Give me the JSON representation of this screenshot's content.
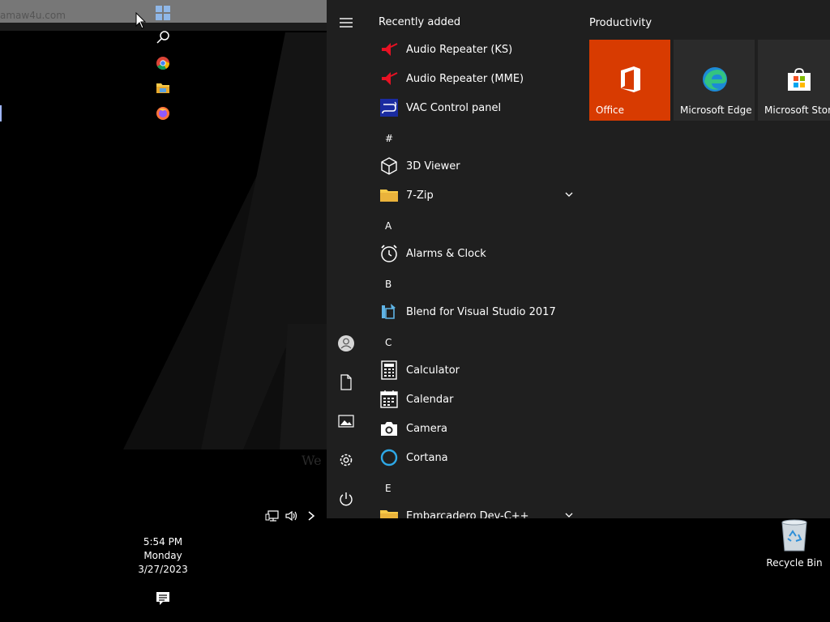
{
  "desktop": {
    "url_fragment": "amaw4u.com",
    "watermark_text": "We"
  },
  "taskbar": {
    "icons": [
      "windows-start-icon",
      "search-icon",
      "chrome-icon",
      "file-explorer-icon",
      "firefox-icon"
    ],
    "tray_icons": [
      "network-icon",
      "volume-icon",
      "chevron-right-icon"
    ],
    "clock": {
      "time": "5:54 PM",
      "day": "Monday",
      "date": "3/27/2023"
    }
  },
  "start_menu": {
    "rail_icons": [
      "hamburger-icon",
      "user-icon",
      "documents-icon",
      "pictures-icon",
      "settings-icon",
      "power-icon"
    ],
    "recently_added_header": "Recently added",
    "recently_added": [
      {
        "label": "Audio Repeater (KS)",
        "icon": "audio-repeater-icon"
      },
      {
        "label": "Audio Repeater (MME)",
        "icon": "audio-repeater-icon"
      },
      {
        "label": "VAC Control panel",
        "icon": "vac-icon"
      }
    ],
    "sections": [
      {
        "letter": "#",
        "apps": [
          {
            "label": "3D Viewer",
            "icon": "cube-icon",
            "expandable": false
          },
          {
            "label": "7-Zip",
            "icon": "folder-icon",
            "expandable": true
          }
        ]
      },
      {
        "letter": "A",
        "apps": [
          {
            "label": "Alarms & Clock",
            "icon": "alarm-clock-icon",
            "expandable": false
          }
        ]
      },
      {
        "letter": "B",
        "apps": [
          {
            "label": "Blend for Visual Studio 2017",
            "icon": "blend-icon",
            "expandable": false
          }
        ]
      },
      {
        "letter": "C",
        "apps": [
          {
            "label": "Calculator",
            "icon": "calculator-icon",
            "expandable": false
          },
          {
            "label": "Calendar",
            "icon": "calendar-icon",
            "expandable": false
          },
          {
            "label": "Camera",
            "icon": "camera-icon",
            "expandable": false
          },
          {
            "label": "Cortana",
            "icon": "cortana-icon",
            "expandable": false
          }
        ]
      },
      {
        "letter": "E",
        "apps": [
          {
            "label": "Embarcadero Dev-C++",
            "icon": "folder-icon",
            "expandable": true
          }
        ]
      }
    ],
    "tile_group": {
      "title": "Productivity",
      "tiles": [
        {
          "label": "Office",
          "icon": "office-icon",
          "bg": "#d83b01"
        },
        {
          "label": "Microsoft Edge",
          "icon": "edge-icon",
          "bg": "#2b2b2b"
        },
        {
          "label": "Microsoft Store",
          "icon": "store-icon",
          "bg": "#2b2b2b"
        }
      ]
    }
  },
  "recycle_bin": {
    "label": "Recycle Bin"
  },
  "colors": {
    "accent": "#d83b01",
    "menu_bg": "#1f1f1f",
    "tile_bg": "#2b2b2b"
  }
}
